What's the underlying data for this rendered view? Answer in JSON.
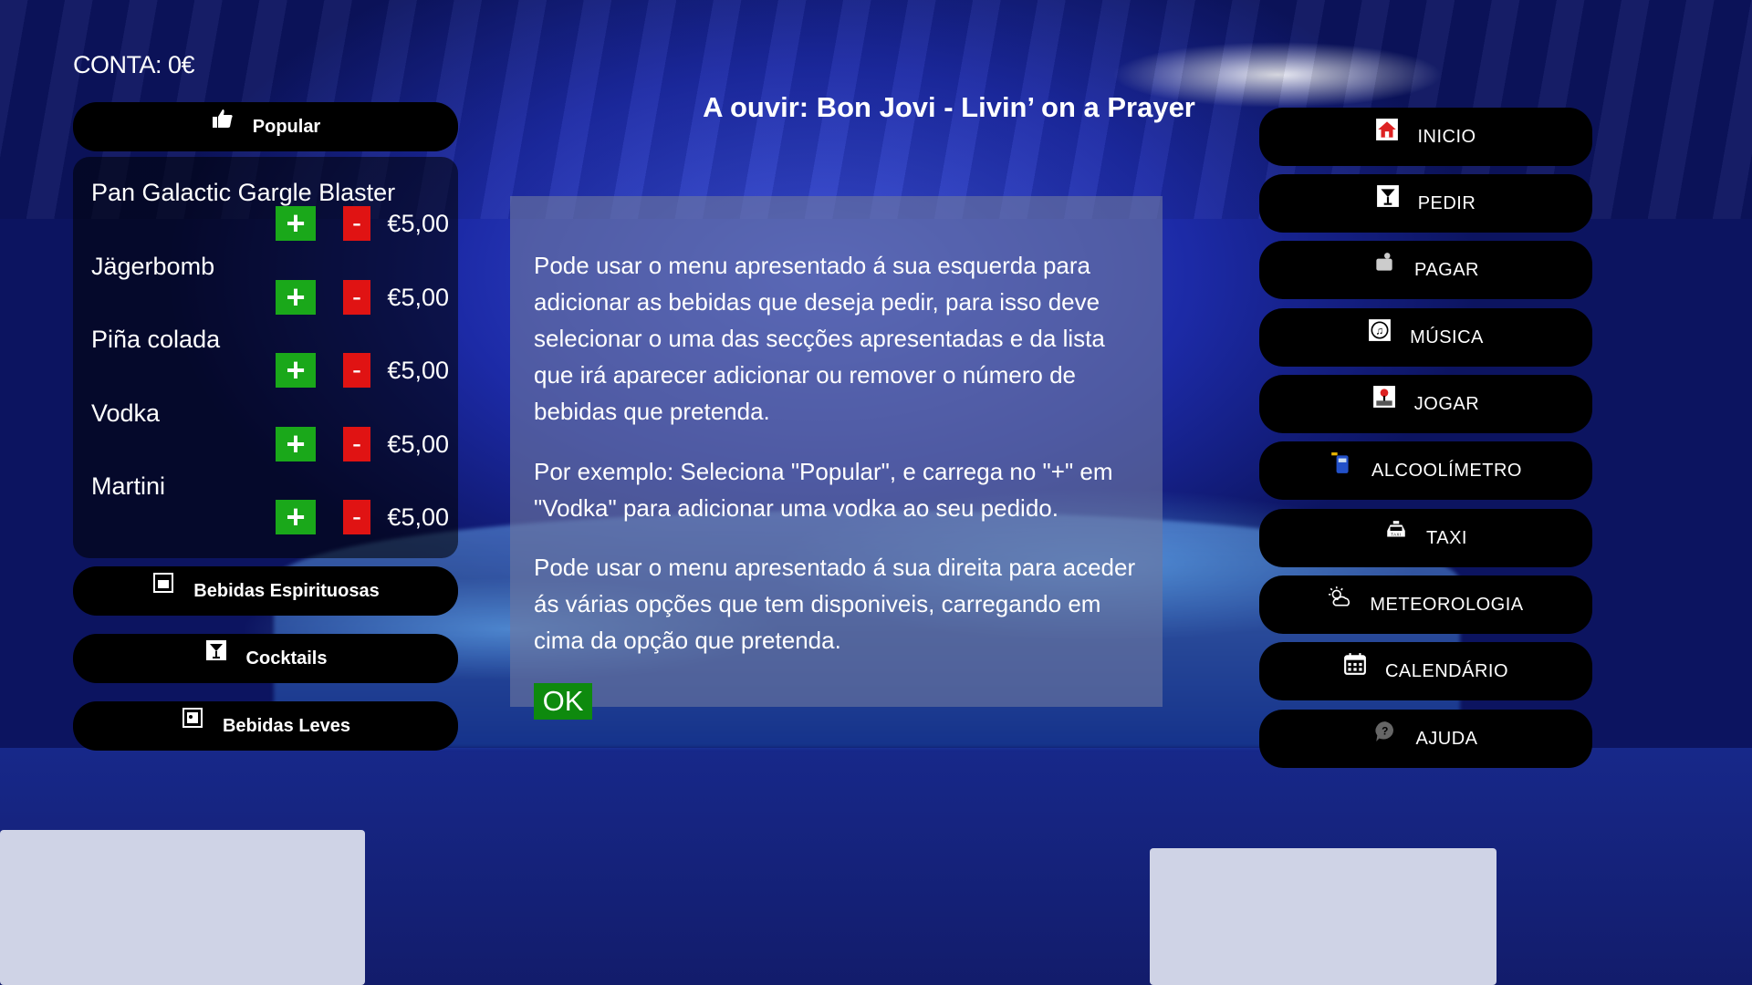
{
  "account": {
    "label": "CONTA: 0€"
  },
  "now_playing": "A ouvir: Bon Jovi - Livin’ on a Prayer",
  "left_menu": {
    "popular": "Popular",
    "spirits": "Bebidas Espirituosas",
    "cocktails": "Cocktails",
    "soft": "Bebidas Leves"
  },
  "drinks": [
    {
      "name": "Pan Galactic Gargle Blaster",
      "price": "€5,00"
    },
    {
      "name": "Jägerbomb",
      "price": "€5,00"
    },
    {
      "name": "Piña colada",
      "price": "€5,00"
    },
    {
      "name": "Vodka",
      "price": "€5,00"
    },
    {
      "name": "Martini",
      "price": "€5,00"
    }
  ],
  "controls": {
    "plus": "+",
    "minus": "-"
  },
  "info": {
    "p1": "Pode usar o menu apresentado á sua esquerda para adicionar as bebidas que deseja pedir, para isso deve selecionar o uma das secções apresentadas e da lista que irá aparecer adicionar ou remover o número de bebidas que pretenda.",
    "p2": "Por exemplo: Seleciona \"Popular\", e carrega no \"+\" em \"Vodka\" para adicionar uma vodka ao seu pedido.",
    "p3": "Pode usar o menu apresentado á sua direita para aceder ás várias opções que tem disponiveis, carregando em cima da opção que pretenda.",
    "ok": "OK"
  },
  "right_menu": [
    {
      "label": "INICIO",
      "icon": "home-icon"
    },
    {
      "label": "PEDIR",
      "icon": "cocktail-icon"
    },
    {
      "label": "PAGAR",
      "icon": "payment-icon"
    },
    {
      "label": "MÚSICA",
      "icon": "music-icon"
    },
    {
      "label": "JOGAR",
      "icon": "joystick-icon"
    },
    {
      "label": "ALCOOLÍMETRO",
      "icon": "breathalyzer-icon"
    },
    {
      "label": "TAXI",
      "icon": "taxi-icon"
    },
    {
      "label": "METEOROLOGIA",
      "icon": "weather-icon"
    },
    {
      "label": "CALENDÁRIO",
      "icon": "calendar-icon"
    },
    {
      "label": "AJUDA",
      "icon": "help-icon"
    }
  ],
  "colors": {
    "plus": "#1aa81a",
    "minus": "#e01313",
    "ok": "#0e8a0e",
    "button_bg": "#000000"
  }
}
